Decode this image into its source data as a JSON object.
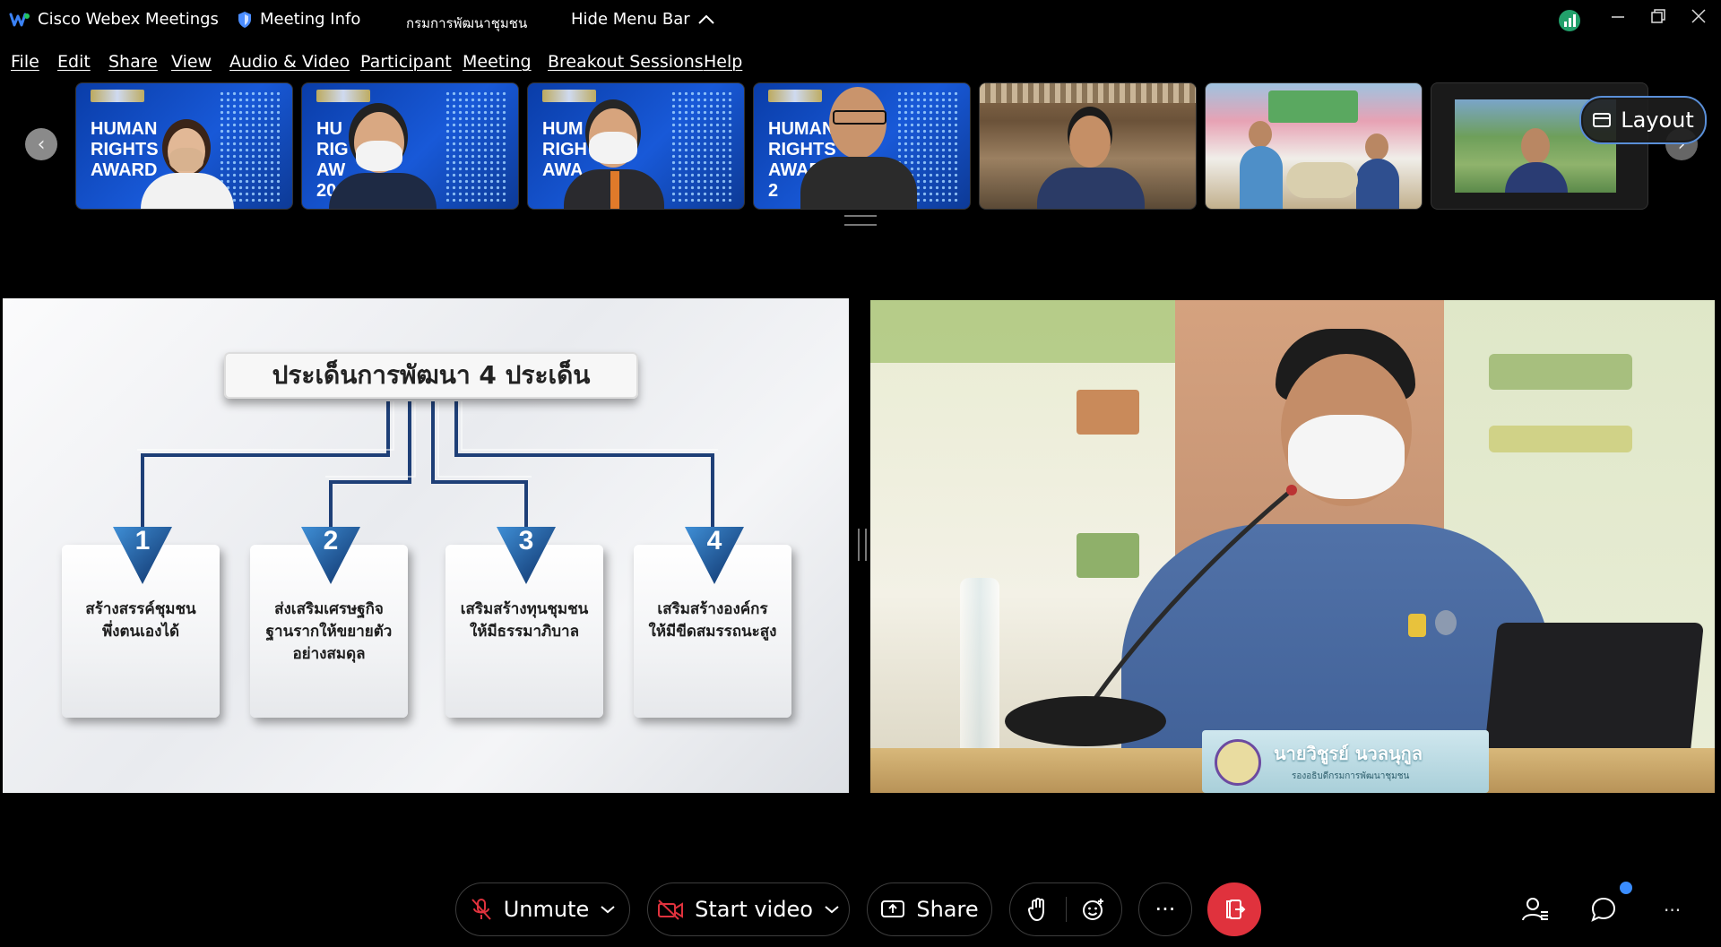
{
  "titlebar": {
    "app_name": "Cisco Webex Meetings",
    "meeting_info": "Meeting Info",
    "host_name": "กรมการพัฒนาชุมชน",
    "hide_menu": "Hide Menu Bar"
  },
  "menu": [
    "File",
    "Edit",
    "Share",
    "View",
    "Audio & Video",
    "Participant",
    "Meeting",
    "Breakout Sessions",
    "Help"
  ],
  "thumbnails": {
    "award_text_lines": [
      "HUMAN",
      "RIGHTS",
      "AWARD"
    ],
    "award_text_partial": [
      [
        "HUMAN",
        "RIGHTS",
        "AWARD"
      ],
      [
        "HU",
        "RIG",
        "AW",
        "20"
      ],
      [
        "HUM",
        "RIGH",
        "AWA"
      ],
      [
        "HUMAN",
        "RIGHTS",
        "AWAR",
        "2"
      ]
    ]
  },
  "layout_button": "Layout",
  "slide": {
    "title": "ประเด็นการพัฒนา 4 ประเด็น",
    "items": [
      {
        "num": "1",
        "lines": [
          "สร้างสรรค์ชุมชน",
          "พึ่งตนเองได้"
        ]
      },
      {
        "num": "2",
        "lines": [
          "ส่งเสริมเศรษฐกิจ",
          "ฐานรากให้ขยายตัว",
          "อย่างสมดุล"
        ]
      },
      {
        "num": "3",
        "lines": [
          "เสริมสร้างทุนชุมชน",
          "ให้มีธรรมาภิบาล"
        ]
      },
      {
        "num": "4",
        "lines": [
          "เสริมสร้างองค์กร",
          "ให้มีขีดสมรรถนะสูง"
        ]
      }
    ]
  },
  "speaker": {
    "nameplate": "นายวิชูรย์ นวลนุกูล",
    "nameplate_sub": "รองอธิบดีกรมการพัฒนาชุมชน"
  },
  "toolbar": {
    "unmute": "Unmute",
    "start_video": "Start video",
    "share": "Share",
    "more": "···",
    "overflow": "···"
  },
  "colors": {
    "accent_blue": "#1a56c4",
    "leave_red": "#e0323d",
    "notification_dot": "#3a8dff",
    "signal_green": "#22a06b"
  }
}
